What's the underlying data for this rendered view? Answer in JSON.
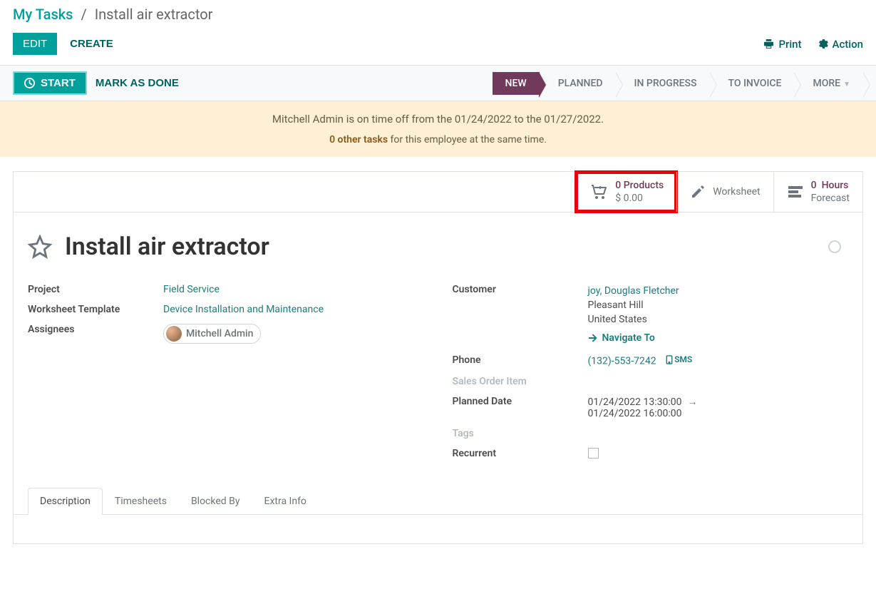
{
  "breadcrumb": {
    "root": "My Tasks",
    "leaf": "Install air extractor"
  },
  "buttons": {
    "edit": "EDIT",
    "create": "CREATE",
    "print": "Print",
    "action": "Action",
    "start": "START",
    "mark_done": "MARK AS DONE"
  },
  "status_steps": [
    "NEW",
    "PLANNED",
    "IN PROGRESS",
    "TO INVOICE",
    "MORE"
  ],
  "banner": {
    "line1": "Mitchell Admin is on time off from the 01/24/2022 to the 01/27/2022.",
    "tasks_link": "0 other tasks",
    "tasks_rest": " for this employee at the same time."
  },
  "stat_buttons": {
    "products": {
      "count": "0",
      "label": "Products",
      "amount": "$ 0.00"
    },
    "worksheet": {
      "label": "Worksheet"
    },
    "forecast": {
      "count": "0",
      "unit": "Hours",
      "label": "Forecast"
    }
  },
  "task": {
    "title": "Install air extractor"
  },
  "fields_left": {
    "project_label": "Project",
    "project_value": "Field Service",
    "wstemplate_label": "Worksheet Template",
    "wstemplate_value": "Device Installation and Maintenance",
    "assignees_label": "Assignees",
    "assignee_name": "Mitchell Admin"
  },
  "fields_right": {
    "customer_label": "Customer",
    "customer_name": "joy, Douglas Fletcher",
    "customer_city": "Pleasant Hill",
    "customer_country": "United States",
    "navigate_label": "Navigate To",
    "phone_label": "Phone",
    "phone_value": "(132)-553-7242",
    "sms_label": "SMS",
    "soi_label": "Sales Order Item",
    "planned_label": "Planned Date",
    "planned_start": "01/24/2022 13:30:00",
    "planned_end": "01/24/2022 16:00:00",
    "tags_label": "Tags",
    "recurrent_label": "Recurrent"
  },
  "tabs": [
    "Description",
    "Timesheets",
    "Blocked By",
    "Extra Info"
  ]
}
